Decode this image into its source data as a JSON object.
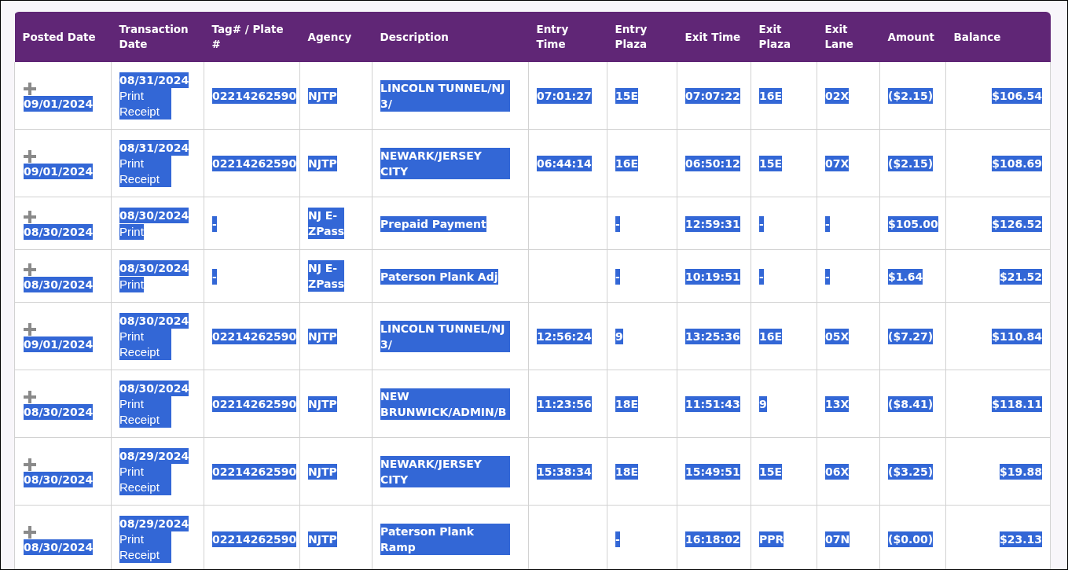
{
  "table": {
    "text_selected": true,
    "columns": [
      "Posted Date",
      "Transaction Date",
      "Tag# / Plate #",
      "Agency",
      "Description",
      "Entry Time",
      "Entry Plaza",
      "Exit Time",
      "Exit Plaza",
      "Exit Lane",
      "Amount",
      "Balance"
    ],
    "rows": [
      {
        "posted_date": "09/01/2024",
        "transaction_date": "08/31/2024",
        "print_link": "Print Receipt",
        "tag": "02214262590",
        "agency": "NJTP",
        "description": "LINCOLN TUNNEL/NJ 3/",
        "entry_time": "07:01:27",
        "entry_plaza": "15E",
        "exit_time": "07:07:22",
        "exit_plaza": "16E",
        "exit_lane": "02X",
        "amount": "($2.15)",
        "balance": "$106.54"
      },
      {
        "posted_date": "09/01/2024",
        "transaction_date": "08/31/2024",
        "print_link": "Print Receipt",
        "tag": "02214262590",
        "agency": "NJTP",
        "description": "NEWARK/JERSEY CITY",
        "entry_time": "06:44:14",
        "entry_plaza": "16E",
        "exit_time": "06:50:12",
        "exit_plaza": "15E",
        "exit_lane": "07X",
        "amount": "($2.15)",
        "balance": "$108.69"
      },
      {
        "posted_date": "08/30/2024",
        "transaction_date": "08/30/2024",
        "print_link": "Print",
        "tag": "-",
        "agency": "NJ E-ZPass",
        "description": "Prepaid Payment",
        "entry_plaza": "-",
        "exit_time": "12:59:31",
        "exit_plaza": "-",
        "exit_lane": "-",
        "amount": "$105.00",
        "balance": "$126.52"
      },
      {
        "posted_date": "08/30/2024",
        "transaction_date": "08/30/2024",
        "print_link": "Print",
        "tag": "-",
        "agency": "NJ E-ZPass",
        "description": "Paterson Plank Adj",
        "entry_plaza": "-",
        "exit_time": "10:19:51",
        "exit_plaza": "-",
        "exit_lane": "-",
        "amount": "$1.64",
        "balance": "$21.52"
      },
      {
        "posted_date": "09/01/2024",
        "transaction_date": "08/30/2024",
        "print_link": "Print Receipt",
        "tag": "02214262590",
        "agency": "NJTP",
        "description": "LINCOLN TUNNEL/NJ 3/",
        "entry_time": "12:56:24",
        "entry_plaza": "9",
        "exit_time": "13:25:36",
        "exit_plaza": "16E",
        "exit_lane": "05X",
        "amount": "($7.27)",
        "balance": "$110.84"
      },
      {
        "posted_date": "08/30/2024",
        "transaction_date": "08/30/2024",
        "print_link": "Print Receipt",
        "tag": "02214262590",
        "agency": "NJTP",
        "description": "NEW BRUNWICK/ADMIN/B",
        "entry_time": "11:23:56",
        "entry_plaza": "18E",
        "exit_time": "11:51:43",
        "exit_plaza": "9",
        "exit_lane": "13X",
        "amount": "($8.41)",
        "balance": "$118.11"
      },
      {
        "posted_date": "08/30/2024",
        "transaction_date": "08/29/2024",
        "print_link": "Print Receipt",
        "tag": "02214262590",
        "agency": "NJTP",
        "description": "NEWARK/JERSEY CITY",
        "entry_time": "15:38:34",
        "entry_plaza": "18E",
        "exit_time": "15:49:51",
        "exit_plaza": "15E",
        "exit_lane": "06X",
        "amount": "($3.25)",
        "balance": "$19.88"
      },
      {
        "posted_date": "08/30/2024",
        "transaction_date": "08/29/2024",
        "print_link": "Print Receipt",
        "tag": "02214262590",
        "agency": "NJTP",
        "description": "Paterson Plank Ramp",
        "entry_plaza": "-",
        "exit_time": "16:18:02",
        "exit_plaza": "PPR",
        "exit_lane": "07N",
        "amount": "($0.00)",
        "balance": "$23.13"
      }
    ]
  }
}
